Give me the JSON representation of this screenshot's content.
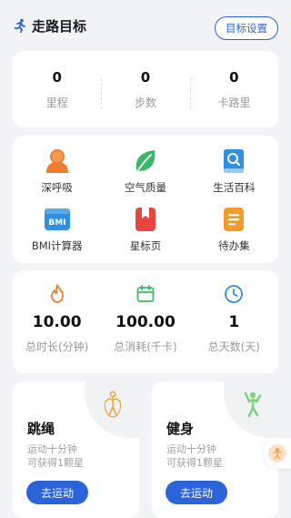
{
  "header": {
    "title": "走路目标",
    "goal_button": "目标设置"
  },
  "stats": [
    {
      "value": "0",
      "label": "里程"
    },
    {
      "value": "0",
      "label": "步数"
    },
    {
      "value": "0",
      "label": "卡路里"
    }
  ],
  "tools": [
    {
      "label": "深呼吸",
      "icon": "person-icon"
    },
    {
      "label": "空气质量",
      "icon": "leaf-icon"
    },
    {
      "label": "生活百科",
      "icon": "book-search-icon"
    },
    {
      "label": "BMI计算器",
      "icon": "bmi-icon"
    },
    {
      "label": "星标页",
      "icon": "bookmark-icon"
    },
    {
      "label": "待办集",
      "icon": "todo-list-icon"
    }
  ],
  "summary": [
    {
      "value": "10.00",
      "label": "总时长(分钟)",
      "icon": "flame-icon"
    },
    {
      "value": "100.00",
      "label": "总消耗(千卡)",
      "icon": "calendar-icon"
    },
    {
      "value": "1",
      "label": "总天数(天)",
      "icon": "clock-icon"
    }
  ],
  "sports": [
    {
      "name": "跳绳",
      "desc1": "运动十分钟",
      "desc2": "可获得1颗星",
      "button": "去运动"
    },
    {
      "name": "健身",
      "desc1": "运动十分钟",
      "desc2": "可获得1颗星",
      "button": "去运动"
    }
  ],
  "bmi_icon_text": "BMI",
  "colors": {
    "accent": "#2a64d8",
    "orange": "#f07a2e",
    "green": "#3cb86a",
    "blue": "#2f8fe0"
  }
}
